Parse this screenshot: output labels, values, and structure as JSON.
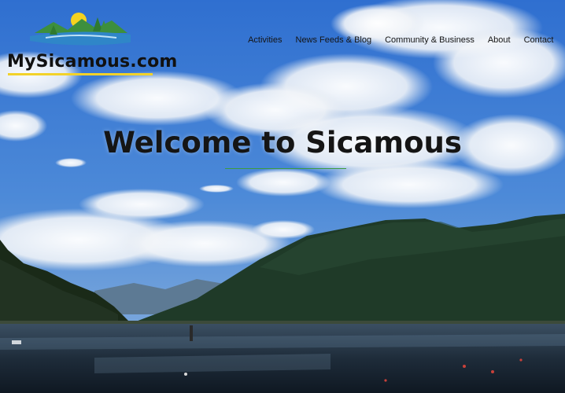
{
  "site": {
    "logo_text": "MySicamous.com"
  },
  "nav": {
    "items": [
      "Activities",
      "News Feeds & Blog",
      "Community & Business",
      "About",
      "Contact"
    ]
  },
  "hero": {
    "headline": "Welcome to Sicamous"
  },
  "colors": {
    "sky": "#3a78cf",
    "accent_rule": "#3d9b3d",
    "logo_underline": "#f2d22a"
  },
  "icons": {
    "logo_graphic": "mountain-lake-sun-logo"
  }
}
